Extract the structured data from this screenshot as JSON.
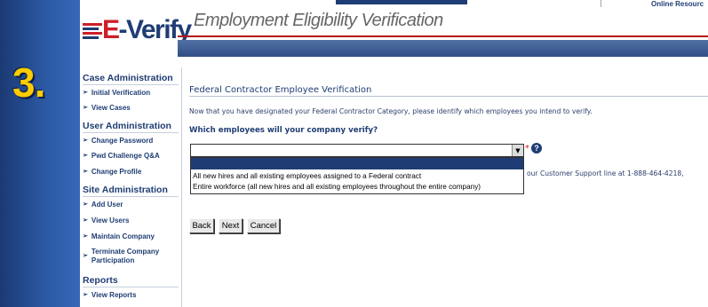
{
  "slide": {
    "step": "3."
  },
  "header": {
    "top_link": "Online Resourc",
    "logo_e": "E",
    "logo_rest": "-Verify",
    "tagline": "Employment Eligibility Verification"
  },
  "sidebar": {
    "sections": [
      {
        "heading": "Case Administration",
        "items": [
          "Initial Verification",
          "View Cases"
        ]
      },
      {
        "heading": "User Administration",
        "items": [
          "Change Password",
          "Pwd Challenge Q&A",
          "Change Profile"
        ]
      },
      {
        "heading": "Site Administration",
        "items": [
          "Add User",
          "View Users",
          "Maintain Company",
          "Terminate Company Participation"
        ]
      },
      {
        "heading": "Reports",
        "items": [
          "View Reports"
        ]
      }
    ],
    "terminate_line1": "Terminate Company",
    "terminate_line2": "Participation"
  },
  "main": {
    "title": "Federal Contractor Employee Verification",
    "intro": "Now that you have designated your Federal Contractor Category, please identify which employees you intend to verify.",
    "question": "Which employees will your company verify?",
    "select": {
      "value": "",
      "options": [
        "",
        "All new hires and all existing employees assigned to a Federal contract",
        "Entire workforce (all new hires and all existing employees throughout the entire company)"
      ]
    },
    "required_mark": "*",
    "help_glyph": "?",
    "support_text": "our Customer Support line at 1-888-464-4218,",
    "buttons": {
      "back": "Back",
      "next": "Next",
      "cancel": "Cancel"
    }
  },
  "colors": {
    "brand_navy": "#1f3d74",
    "brand_red": "#cc1f2b",
    "step_yellow": "#ffcc00"
  },
  "icons": {
    "help": "help-icon",
    "dropdown_arrow": "chevron-down-icon",
    "nav_arrow": "chevron-right-icon"
  }
}
